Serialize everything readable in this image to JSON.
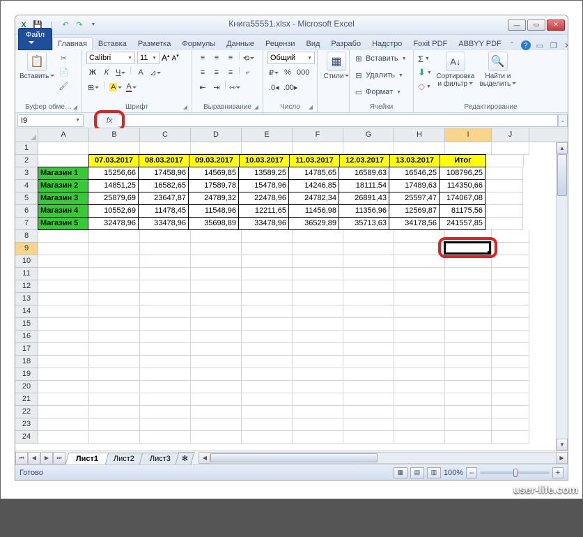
{
  "window": {
    "title": "Книга55551.xlsx - Microsoft Excel"
  },
  "qat": {
    "excel": "X",
    "save": "💾",
    "undo": "↶",
    "redo": "↷"
  },
  "winbtns": {
    "min": "—",
    "max": "▭",
    "close": "✕"
  },
  "ribbon": {
    "file": "Файл",
    "tabs": [
      "Главная",
      "Вставка",
      "Разметка",
      "Формулы",
      "Данные",
      "Рецензи",
      "Вид",
      "Разрабо",
      "Надстро",
      "Foxit PDF",
      "ABBYY PDF"
    ],
    "active_idx": 0,
    "help": "?",
    "groups": {
      "clipboard": {
        "label": "Буфер обме…",
        "paste": "Вставить",
        "cut": "✂",
        "copy": "📄",
        "painter": "🖌"
      },
      "font": {
        "label": "Шрифт",
        "name": "Calibri",
        "size": "11",
        "bold": "Ж",
        "italic": "К",
        "underline": "Ч",
        "border": "⊞",
        "grow": "A",
        "shrink": "A",
        "fill": "A",
        "color": "A"
      },
      "align": {
        "label": "Выравнивание",
        "wrap": "⤶",
        "merge": "⇿"
      },
      "number": {
        "label": "Число",
        "format": "Общий",
        "percent": "%",
        "comma": ",",
        "inc": ".0",
        "dec": ".00"
      },
      "styles": {
        "label": "",
        "styles": "Стили"
      },
      "cells": {
        "label": "Ячейки",
        "insert": "Вставить",
        "delete": "Удалить",
        "format": "Формат"
      },
      "editing": {
        "label": "Редактирование",
        "sum": "Σ",
        "fill": "⬇",
        "clear": "◇",
        "sort": "Сортировка\nи фильтр",
        "find": "Найти и\nвыделить"
      }
    }
  },
  "fx": {
    "cellref": "I9",
    "fx": "fx",
    "formula": ""
  },
  "columns": [
    "A",
    "B",
    "C",
    "D",
    "E",
    "F",
    "G",
    "H",
    "I",
    "J"
  ],
  "col_widths": [
    "cA",
    "cB",
    "cC",
    "cD",
    "cE",
    "cF",
    "cG",
    "cH",
    "cI",
    "cJ"
  ],
  "sel": {
    "col": "I",
    "row": 9
  },
  "headers_row": 2,
  "headers": [
    "",
    "07.03.2017",
    "08.03.2017",
    "09.03.2017",
    "10.03.2017",
    "11.03.2017",
    "12.03.2017",
    "13.03.2017",
    "Итог"
  ],
  "data_rows": [
    {
      "store": "Магазин 1",
      "vals": [
        "15256,66",
        "17458,96",
        "14569,85",
        "13589,25",
        "14785,65",
        "16589,63",
        "16546,25",
        "108796,25"
      ]
    },
    {
      "store": "Магазин 2",
      "vals": [
        "14851,25",
        "16582,65",
        "17589,78",
        "15478,96",
        "14246,85",
        "18111,54",
        "17489,63",
        "114350,66"
      ]
    },
    {
      "store": "Магазин 3",
      "vals": [
        "25879,69",
        "23647,87",
        "24789,32",
        "22478,96",
        "24782,34",
        "26891,43",
        "25597,47",
        "174067,08"
      ]
    },
    {
      "store": "Магазин 4",
      "vals": [
        "10552,69",
        "11478,45",
        "11548,96",
        "12211,65",
        "11456,98",
        "11356,96",
        "12569,87",
        "81175,56"
      ]
    },
    {
      "store": "Магазин 5",
      "vals": [
        "32478,96",
        "33478,96",
        "35698,89",
        "33478,96",
        "36529,89",
        "35713,63",
        "34178,56",
        "241557,85"
      ]
    }
  ],
  "total_rows": 24,
  "sheets": {
    "nav": [
      "⏮",
      "◀",
      "▶",
      "⏭"
    ],
    "tabs": [
      "Лист1",
      "Лист2",
      "Лист3"
    ],
    "active": 0,
    "add": "✻"
  },
  "status": {
    "ready": "Готово",
    "zoom": "100%",
    "minus": "–",
    "plus": "+"
  },
  "watermark": "user-life.com"
}
